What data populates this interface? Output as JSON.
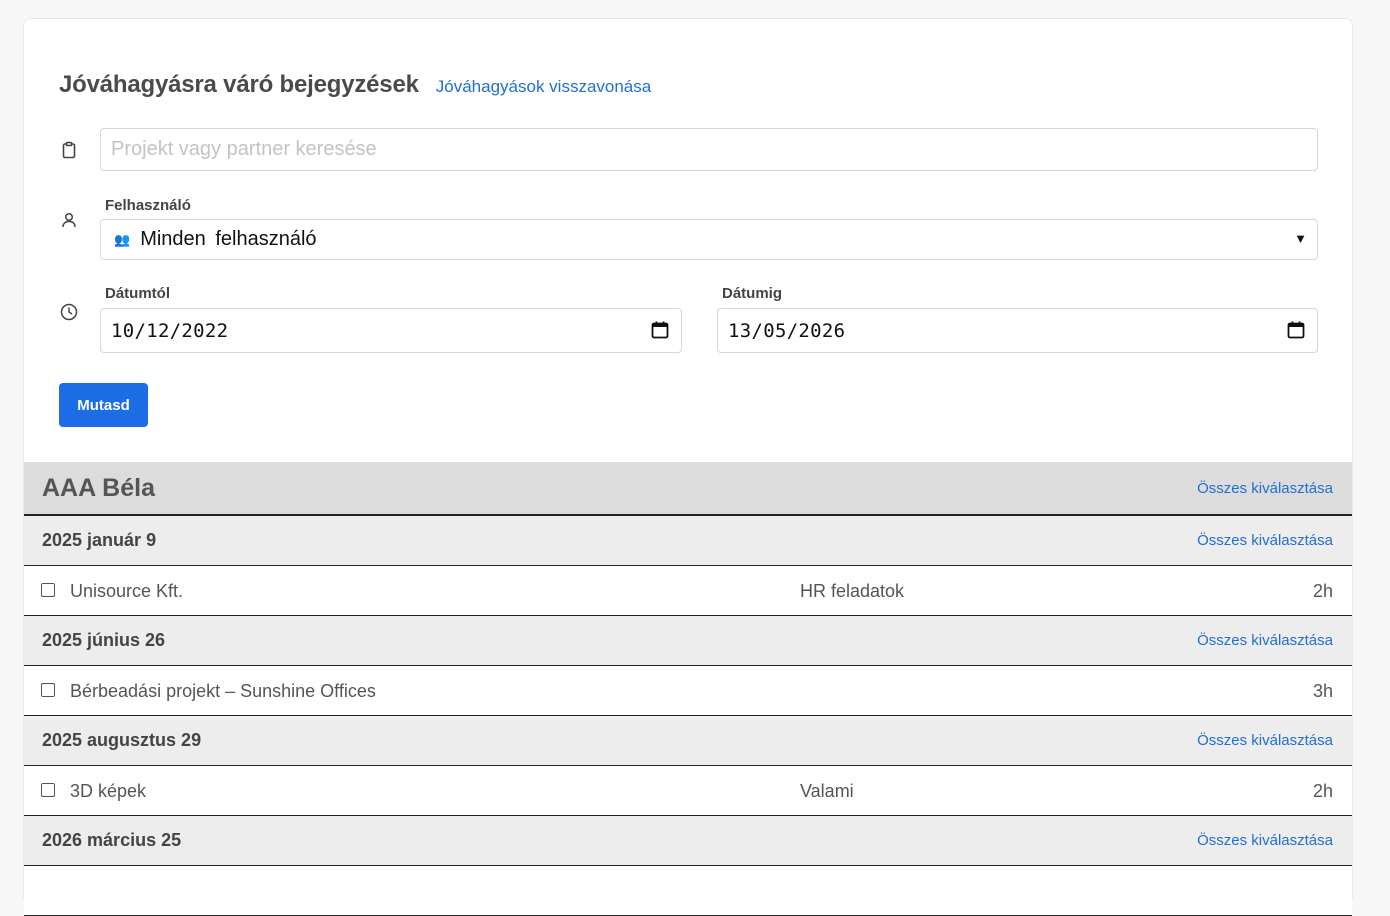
{
  "header": {
    "title": "Jóváhagyásra váró bejegyzések",
    "revoke_link": "Jóváhagyások visszavonása"
  },
  "filters": {
    "search_placeholder": "Projekt vagy partner keresése",
    "search_value": "",
    "user_label": "Felhasználó",
    "user_icon": "👥",
    "user_selected": "Minden felhasználó",
    "date_from_label": "Dátumtól",
    "date_from_value": "10/12/2022",
    "date_to_label": "Dátumig",
    "date_to_value": "13/05/2026",
    "submit_label": "Mutasd"
  },
  "icons": {
    "search_row": "clipboard-icon",
    "user_row": "user-icon",
    "date_row": "clock-icon",
    "date_picker": "calendar-icon"
  },
  "colors": {
    "accent": "#1c6ce6",
    "link": "#1f6fd6",
    "user_header_bg": "#dcdcdc",
    "date_header_bg": "#ededed"
  },
  "list": {
    "user": {
      "name": "AAA Béla",
      "select_all": "Összes kiválasztása"
    },
    "groups": [
      {
        "date": "2025 január 9",
        "select_all": "Összes kiválasztása",
        "entries": [
          {
            "project": "Unisource Kft.",
            "task": "HR feladatok",
            "hours": "2h",
            "checked": false
          }
        ]
      },
      {
        "date": "2025 június 26",
        "select_all": "Összes kiválasztása",
        "entries": [
          {
            "project": "Bérbeadási projekt – Sunshine Offices",
            "task": "",
            "hours": "3h",
            "checked": false
          }
        ]
      },
      {
        "date": "2025 augusztus 29",
        "select_all": "Összes kiválasztása",
        "entries": [
          {
            "project": "3D képek",
            "task": "Valami",
            "hours": "2h",
            "checked": false
          }
        ]
      },
      {
        "date": "2026 március 25",
        "select_all": "Összes kiválasztása",
        "entries": []
      }
    ]
  }
}
